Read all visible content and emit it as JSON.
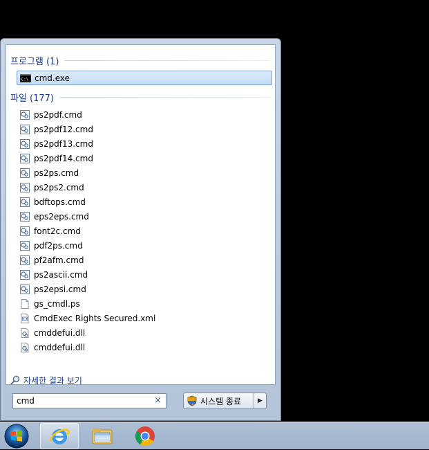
{
  "start_menu": {
    "programs_header": "프로그램 (1)",
    "programs": [
      {
        "label": "cmd.exe",
        "icon": "console-icon"
      }
    ],
    "files_header": "파일 (177)",
    "files": [
      {
        "label": "ps2pdf.cmd",
        "icon": "cmd-script-icon"
      },
      {
        "label": "ps2pdf12.cmd",
        "icon": "cmd-script-icon"
      },
      {
        "label": "ps2pdf13.cmd",
        "icon": "cmd-script-icon"
      },
      {
        "label": "ps2pdf14.cmd",
        "icon": "cmd-script-icon"
      },
      {
        "label": "ps2ps.cmd",
        "icon": "cmd-script-icon"
      },
      {
        "label": "ps2ps2.cmd",
        "icon": "cmd-script-icon"
      },
      {
        "label": "bdftops.cmd",
        "icon": "cmd-script-icon"
      },
      {
        "label": "eps2eps.cmd",
        "icon": "cmd-script-icon"
      },
      {
        "label": "font2c.cmd",
        "icon": "cmd-script-icon"
      },
      {
        "label": "pdf2ps.cmd",
        "icon": "cmd-script-icon"
      },
      {
        "label": "pf2afm.cmd",
        "icon": "cmd-script-icon"
      },
      {
        "label": "ps2ascii.cmd",
        "icon": "cmd-script-icon"
      },
      {
        "label": "ps2epsi.cmd",
        "icon": "cmd-script-icon"
      },
      {
        "label": "gs_cmdl.ps",
        "icon": "blank-file-icon"
      },
      {
        "label": "CmdExec Rights Secured.xml",
        "icon": "xml-file-icon"
      },
      {
        "label": "cmddefui.dll",
        "icon": "dll-file-icon"
      },
      {
        "label": "cmddefui.dll",
        "icon": "dll-file-icon"
      }
    ],
    "see_more": "자세한 결과 보기",
    "search": {
      "value": "cmd",
      "clear_glyph": "×"
    },
    "shutdown": {
      "label": "시스템 종료",
      "arrow": "▶"
    }
  },
  "taskbar": {
    "items": [
      {
        "name": "internet-explorer",
        "active": true
      },
      {
        "name": "file-explorer",
        "active": false
      },
      {
        "name": "chrome",
        "active": false
      }
    ]
  },
  "colors": {
    "accent": "#1e3c8c",
    "selection": "#c4dcf6",
    "taskbar": "#aebfd4"
  }
}
